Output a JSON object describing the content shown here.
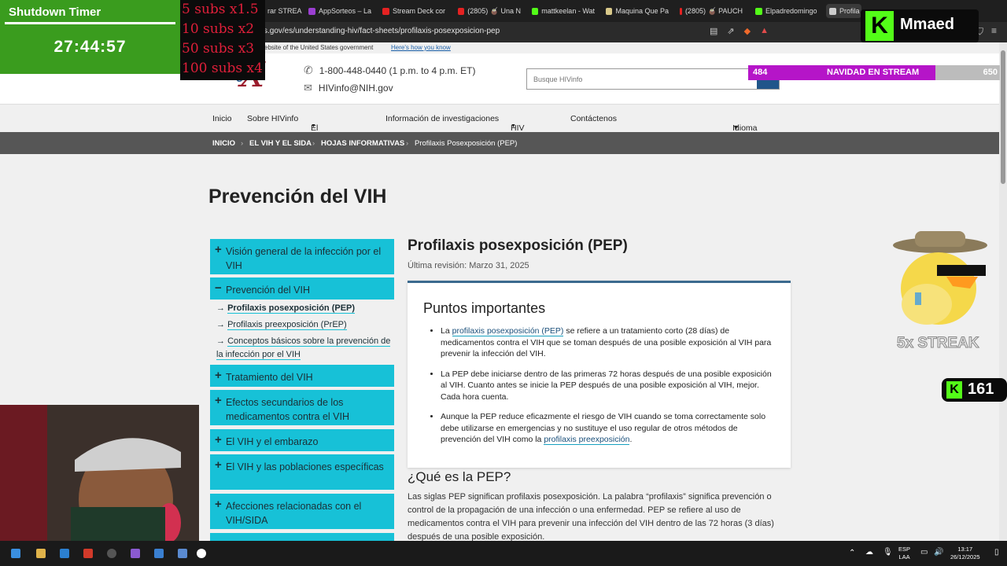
{
  "browser": {
    "tabs": [
      "rar STREA",
      "AppSorteos – La",
      "Stream Deck cor",
      "(2805) 🧉 Una N",
      "mattkeelan - Wat",
      "Maquina Que Pa",
      "(2805) 🧉 PAUCH",
      "Elpadredomingo",
      "Profila"
    ],
    "url": "s.gov/es/understanding-hiv/fact-sheets/profilaxis-posexposicion-pep"
  },
  "site": {
    "gov_banner": "ebsite of the United States government",
    "how_link": "Here's how you know",
    "logo": "NIH.gov",
    "phone": "1-800-448-0440 (1 p.m. to 4 p.m. ET)",
    "email": "HIVinfo@NIH.gov",
    "search_placeholder": "Busque HIVinfo",
    "nav": [
      "Inicio",
      "Sobre HIVinfo",
      "El VIH y El Sida",
      "Información de investigaciones",
      "HIV Source",
      "Contáctenos"
    ],
    "language": "Idioma (ES)",
    "breadcrumb": [
      "INICIO",
      "EL VIH Y EL SIDA",
      "HOJAS INFORMATIVAS",
      "Profilaxis Posexposición (PEP)"
    ],
    "page_title": "Prevención del VIH",
    "sidebar": {
      "visión": "Visión general de la infección por el VIH",
      "prevención": "Prevención del VIH",
      "sub": [
        "Profilaxis posexposición (PEP)",
        "Profilaxis preexposición (PrEP)",
        "Conceptos básicos sobre la prevención de la infección por el VIH"
      ],
      "tratamiento": "Tratamiento del VIH",
      "efectos": "Efectos secundarios de los medicamentos contra el VIH",
      "embarazo": "El VIH y el embarazo",
      "poblaciones": "El VIH y las poblaciones específicas",
      "afecciones": "Afecciones relacionadas con el VIH/SIDA"
    },
    "article_title": "Profilaxis posexposición (PEP)",
    "revision": "Última revisión: Marzo 31, 2025",
    "key_points_title": "Puntos importantes",
    "kp1_a": "La ",
    "kp1_link": "profilaxis posexposición (PEP)",
    "kp1_b": " se refiere a un tratamiento corto (28 días) de medicamentos contra el VIH que se toman después de una posible exposición al VIH para prevenir la infección del VIH.",
    "kp2": "La PEP debe iniciarse dentro de las primeras 72 horas después de una posible exposición al VIH. Cuanto antes se inicie la PEP después de una posible exposición al VIH, mejor. Cada hora cuenta.",
    "kp3_a": "Aunque la PEP reduce eficazmente el riesgo de VIH cuando se toma correctamente solo debe utilizarse en emergencias y no sustituye el uso regular de otros métodos de prevención del VIH como la ",
    "kp3_link": "profilaxis preexposición",
    "kp3_b": ".",
    "section_title": "¿Qué es la PEP?",
    "section_text": "Las siglas PEP significan profilaxis posexposición. La palabra “profilaxis” significa prevención o control de la propagación de una infección o una enfermedad. PEP se refiere al uso de medicamentos contra el VIH para prevenir una infección del VIH dentro de las 72 horas (3 días) después de una posible exposición."
  },
  "overlay": {
    "timer_title": "Shutdown Timer",
    "timer_value": "27:44:57",
    "subs": [
      "5 subs x1.5",
      "10 subs x2",
      "50 subs x3",
      "100 subs x4"
    ],
    "kick_name": "Mmaed",
    "goal_current": "484",
    "goal_label": "NAVIDAD EN STREAM",
    "goal_target": "650",
    "goal_progress": 0.745,
    "streak": "5x STREAK",
    "kick_count": "161",
    "brand_color": "#53fc18"
  },
  "taskbar": {
    "lang": "ESP",
    "layout": "LAA",
    "time": "13:17",
    "date": "26/12/2025"
  }
}
